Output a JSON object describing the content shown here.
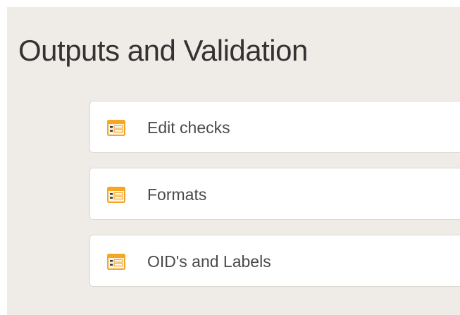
{
  "page": {
    "title": "Outputs and Validation"
  },
  "items": [
    {
      "label": "Edit checks",
      "icon": "form-list-icon"
    },
    {
      "label": "Formats",
      "icon": "form-list-icon"
    },
    {
      "label": "OID's and Labels",
      "icon": "form-list-icon"
    }
  ],
  "colors": {
    "background": "#efebe7",
    "card": "#ffffff",
    "icon_accent": "#f5a623",
    "title_text": "#333333"
  }
}
